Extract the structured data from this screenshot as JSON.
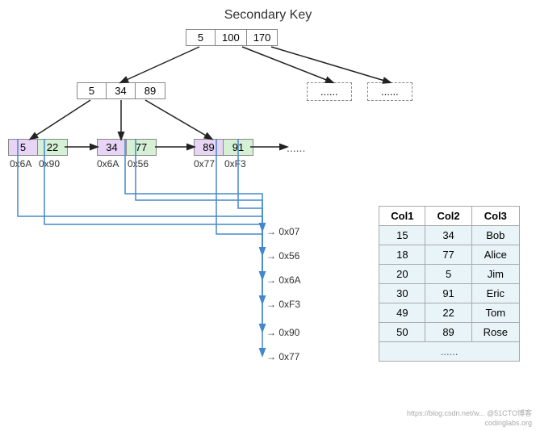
{
  "title": "Secondary Key",
  "root_node": {
    "cells": [
      "5",
      "100",
      "170"
    ]
  },
  "level2_node": {
    "cells": [
      "5",
      "34",
      "89"
    ]
  },
  "level2_dashed1": "......",
  "level2_dashed2": "......",
  "leaf_nodes": [
    {
      "cells": [
        {
          "val": "5",
          "type": "purple"
        },
        {
          "val": "22",
          "type": "green"
        }
      ],
      "sub": [
        "0x6A",
        "0x90"
      ]
    },
    {
      "cells": [
        {
          "val": "34",
          "type": "purple"
        },
        {
          "val": "77",
          "type": "green"
        }
      ],
      "sub": [
        "0x6A",
        "0x56"
      ]
    },
    {
      "cells": [
        {
          "val": "89",
          "type": "purple"
        },
        {
          "val": "91",
          "type": "green"
        }
      ],
      "sub": [
        "0x77",
        "0xF3"
      ]
    }
  ],
  "hex_labels": [
    "0x07",
    "0x56",
    "0x6A",
    "0xF3",
    "0x90",
    "0x77"
  ],
  "dots_mid": "......",
  "table": {
    "headers": [
      "Col1",
      "Col2",
      "Col3"
    ],
    "rows": [
      [
        "15",
        "34",
        "Bob"
      ],
      [
        "18",
        "77",
        "Alice"
      ],
      [
        "20",
        "5",
        "Jim"
      ],
      [
        "30",
        "91",
        "Eric"
      ],
      [
        "49",
        "22",
        "Tom"
      ],
      [
        "50",
        "89",
        "Rose"
      ]
    ],
    "dots": "......"
  },
  "watermark": {
    "line1": "https://blog.csdn.net/w... @51CTO博客",
    "line2": "codinglabs.org"
  }
}
